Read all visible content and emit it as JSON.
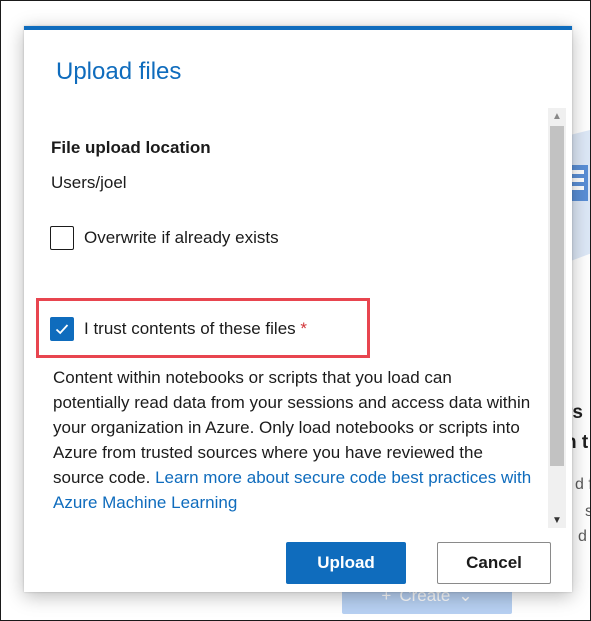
{
  "background": {
    "side_text_1": "rs",
    "side_text_2": "n t",
    "side_small_1": "d f",
    "side_small_2": "s",
    "side_small_3": "d",
    "create_label": "Create",
    "create_icon": "plus-icon",
    "create_chevron_icon": "chevron-down-icon"
  },
  "dialog": {
    "title": "Upload files",
    "location_heading": "File upload location",
    "location_value": "Users/joel",
    "overwrite_label": "Overwrite if already exists",
    "overwrite_checked": false,
    "trust_label": "I trust contents of these files",
    "trust_required_marker": "*",
    "trust_checked": true,
    "description": "Content within notebooks or scripts that you load can potentially read data from your sessions and access data within your organization in Azure. Only load notebooks or scripts into Azure from trusted sources where you have reviewed the source code.",
    "link_text": "Learn more about secure code best practices with Azure Machine Learning",
    "upload_label": "Upload",
    "cancel_label": "Cancel"
  },
  "colors": {
    "accent": "#0f6cbd",
    "highlight": "#e8454f",
    "required": "#d13438"
  }
}
